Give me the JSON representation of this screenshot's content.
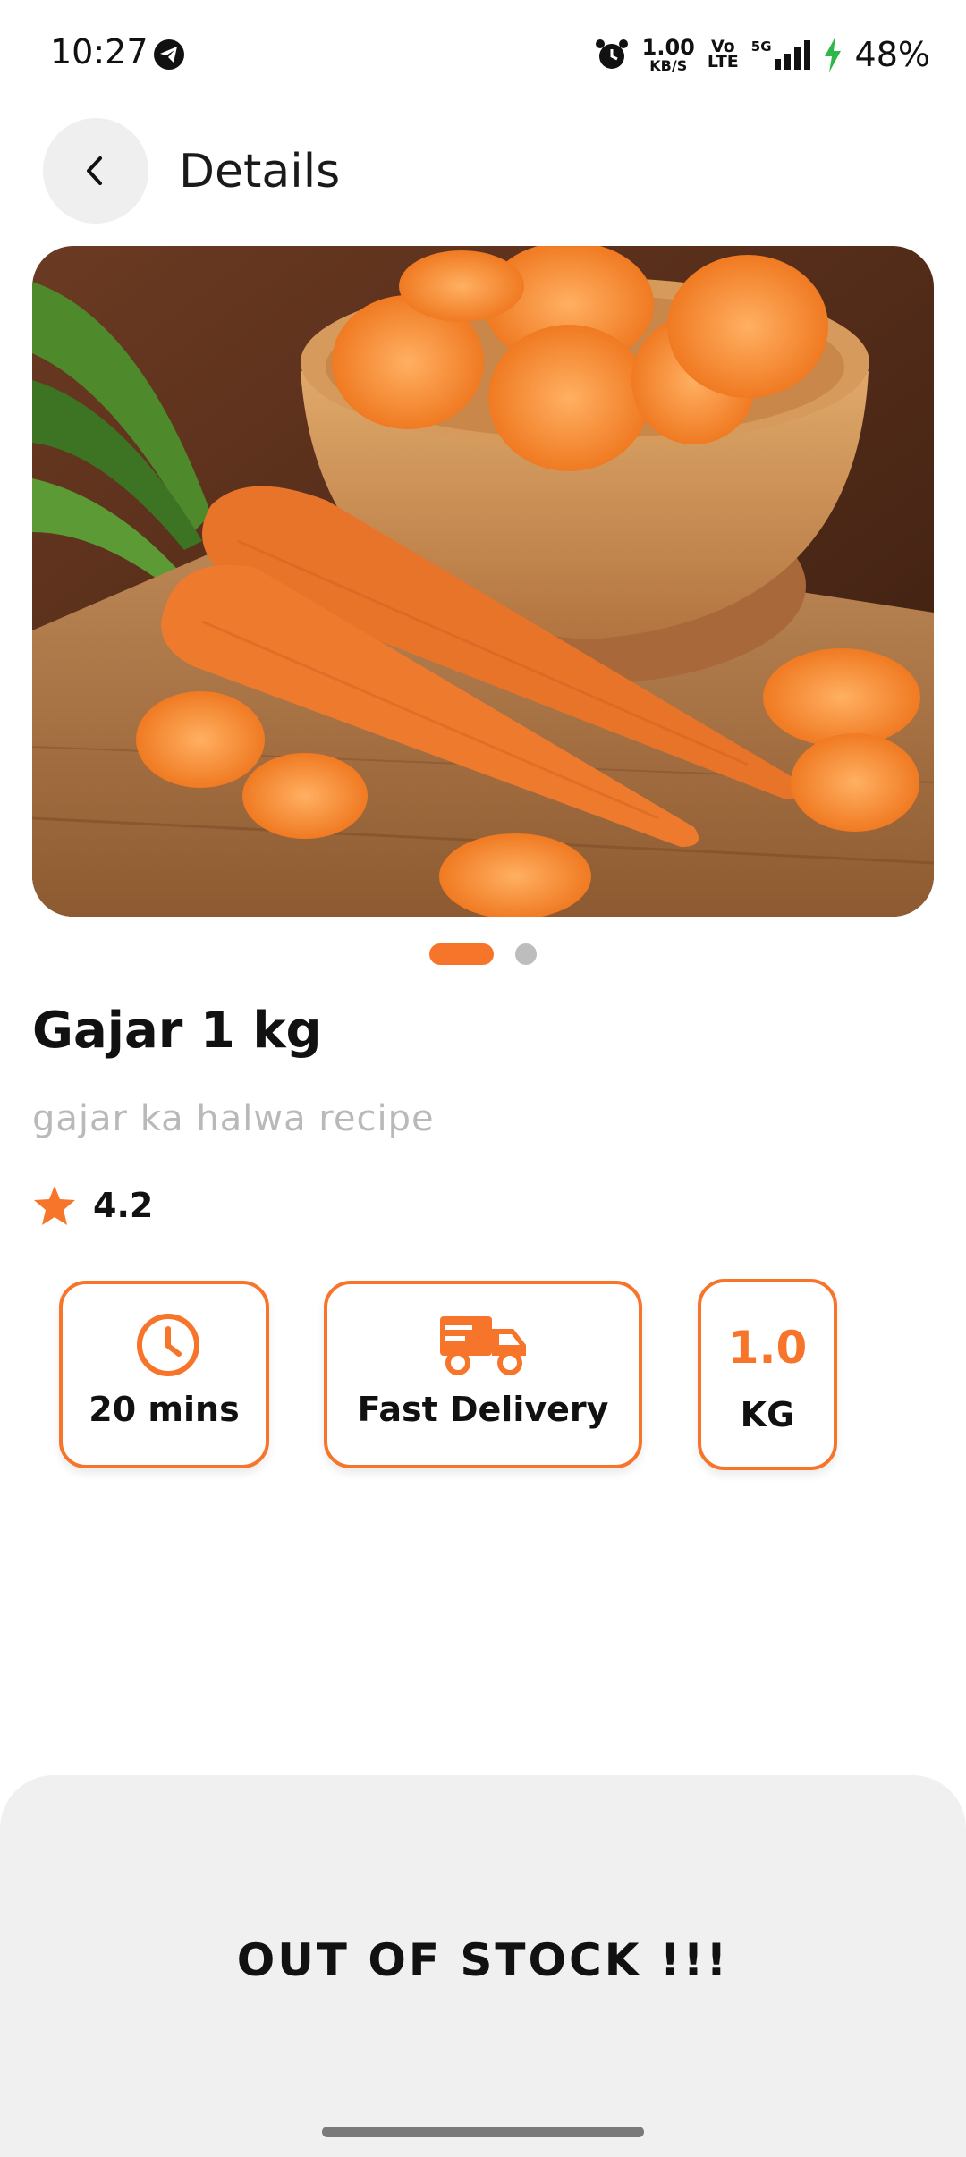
{
  "status_bar": {
    "time": "10:27",
    "net_speed_value": "1.00",
    "net_speed_unit": "KB/S",
    "volte_top": "Vo",
    "volte_bottom": "LTE",
    "network": "5G",
    "battery": "48%",
    "icons": [
      "telegram-icon",
      "alarm-icon",
      "signal-icon",
      "charging-icon"
    ]
  },
  "header": {
    "back_icon": "chevron-left-icon",
    "title": "Details"
  },
  "carousel": {
    "image_icon": "carrots-photo",
    "slide_count": 2,
    "active_index": 0
  },
  "product": {
    "name": "Gajar 1 kg",
    "subtitle": "gajar ka halwa recipe",
    "rating": "4.2",
    "rating_icon": "star-icon"
  },
  "chips": {
    "time": {
      "icon": "clock-icon",
      "label": "20 mins"
    },
    "delivery": {
      "icon": "truck-icon",
      "label": "Fast Delivery"
    },
    "quantity": {
      "value": "1.0",
      "unit": "KG"
    }
  },
  "footer": {
    "status_text": "OUT OF STOCK !!!"
  },
  "colors": {
    "accent": "#f7752a",
    "muted_text": "#b9b9b9",
    "panel": "#f0f0f0"
  }
}
